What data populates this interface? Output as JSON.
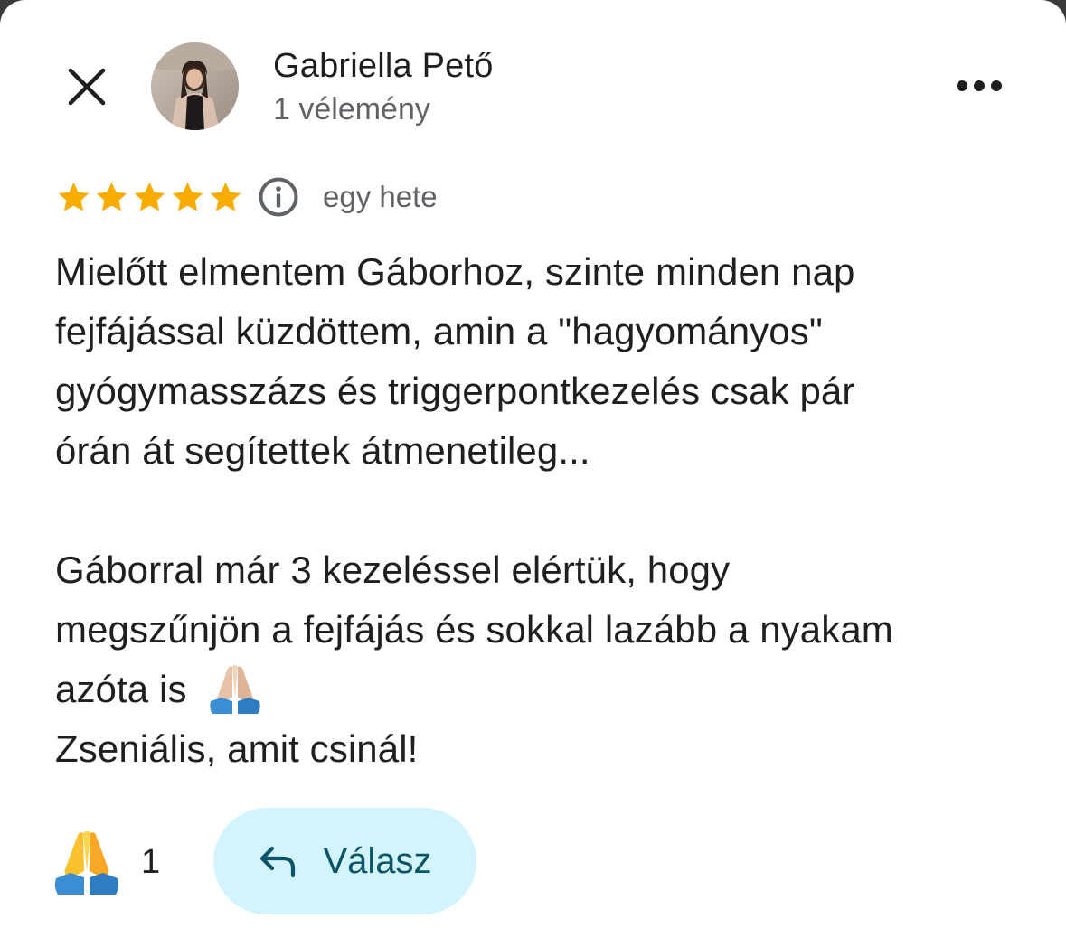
{
  "header": {
    "close_icon": "close-icon",
    "more_icon": "more-horizontal-icon"
  },
  "author": {
    "name": "Gabriella Pető",
    "reviews": "1 vélemény"
  },
  "rating": {
    "stars": 5,
    "max_stars": 5,
    "star_color": "#f9ab00",
    "time": "egy hete"
  },
  "review": {
    "text": "Mielőtt elmentem Gáborhoz, szinte minden nap\nfejfájással küzdöttem, amin a \"hagyományos\"\ngyógymasszázs és triggerpontkezelés csak pár\nórán át segítettek átmenetileg...\n\nGáborral már 3 kezeléssel elértük, hogy\nmegszűnjön a fejfájás és sokkal lazább a nyakam\nazóta is\nZseniális, amit csinál!"
  },
  "footer": {
    "reaction_count": "1",
    "reaction_icon": "folded-hands-icon",
    "reply_label": "Válasz",
    "reply_color": "#d3f4fc"
  }
}
